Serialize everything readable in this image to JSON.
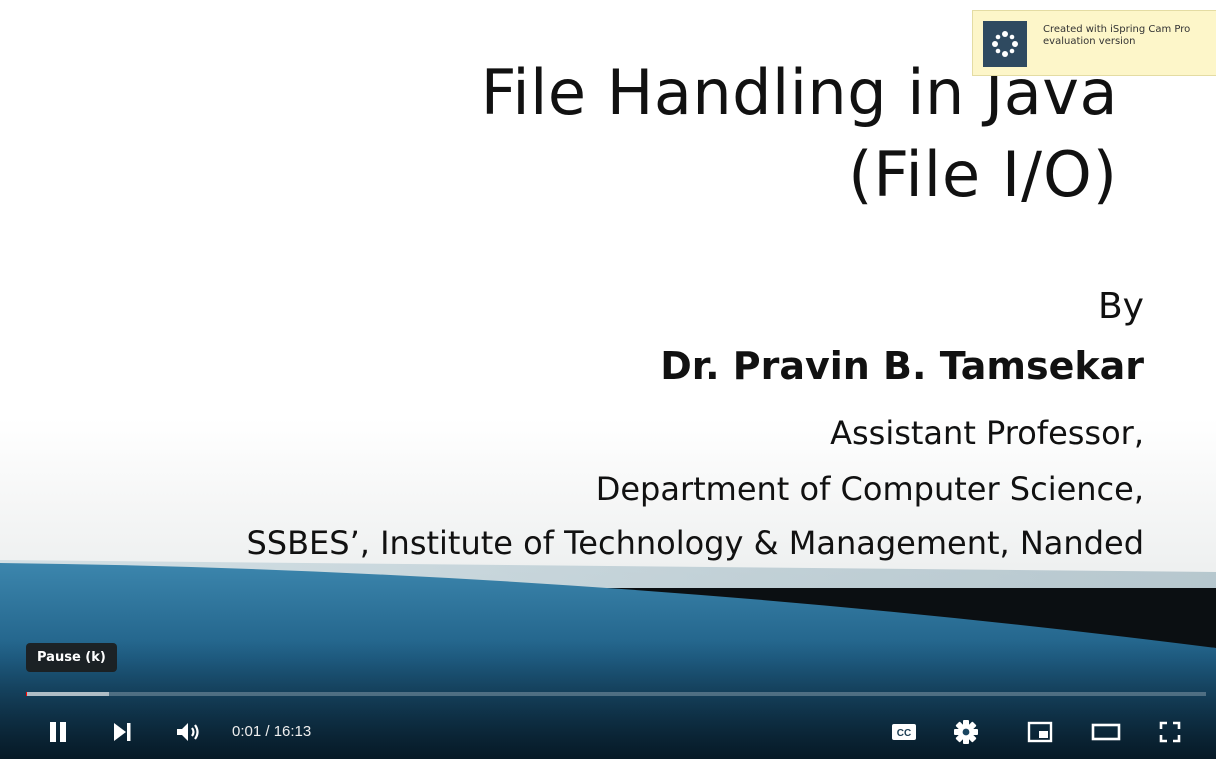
{
  "slide": {
    "title_line1": "File Handling in Java",
    "title_line2": "(File I/O)",
    "by": "By",
    "author": "Dr. Pravin B. Tamsekar",
    "role": "Assistant Professor,",
    "department": "Department of Computer Science,",
    "institute": "SSBES’, Institute of Technology & Management, Nanded"
  },
  "watermark": {
    "line1": "Created with iSpring Cam Pro",
    "line2": "evaluation version"
  },
  "tooltip": "Pause (k)",
  "player": {
    "current_time": "0:01",
    "duration": "16:13",
    "time_display": "0:01 / 16:13",
    "played_fraction": 0.001,
    "buffered_fraction": 0.07,
    "cc_label": "CC"
  },
  "colors": {
    "progress_played": "#ff0000",
    "wave_blue": "#1f5f86",
    "wave_dark": "#0b0f12"
  },
  "icons": [
    "pause-icon",
    "next-icon",
    "volume-icon",
    "cc-icon",
    "settings-icon",
    "miniplayer-icon",
    "theater-icon",
    "fullscreen-icon",
    "ispring-logo-icon"
  ]
}
